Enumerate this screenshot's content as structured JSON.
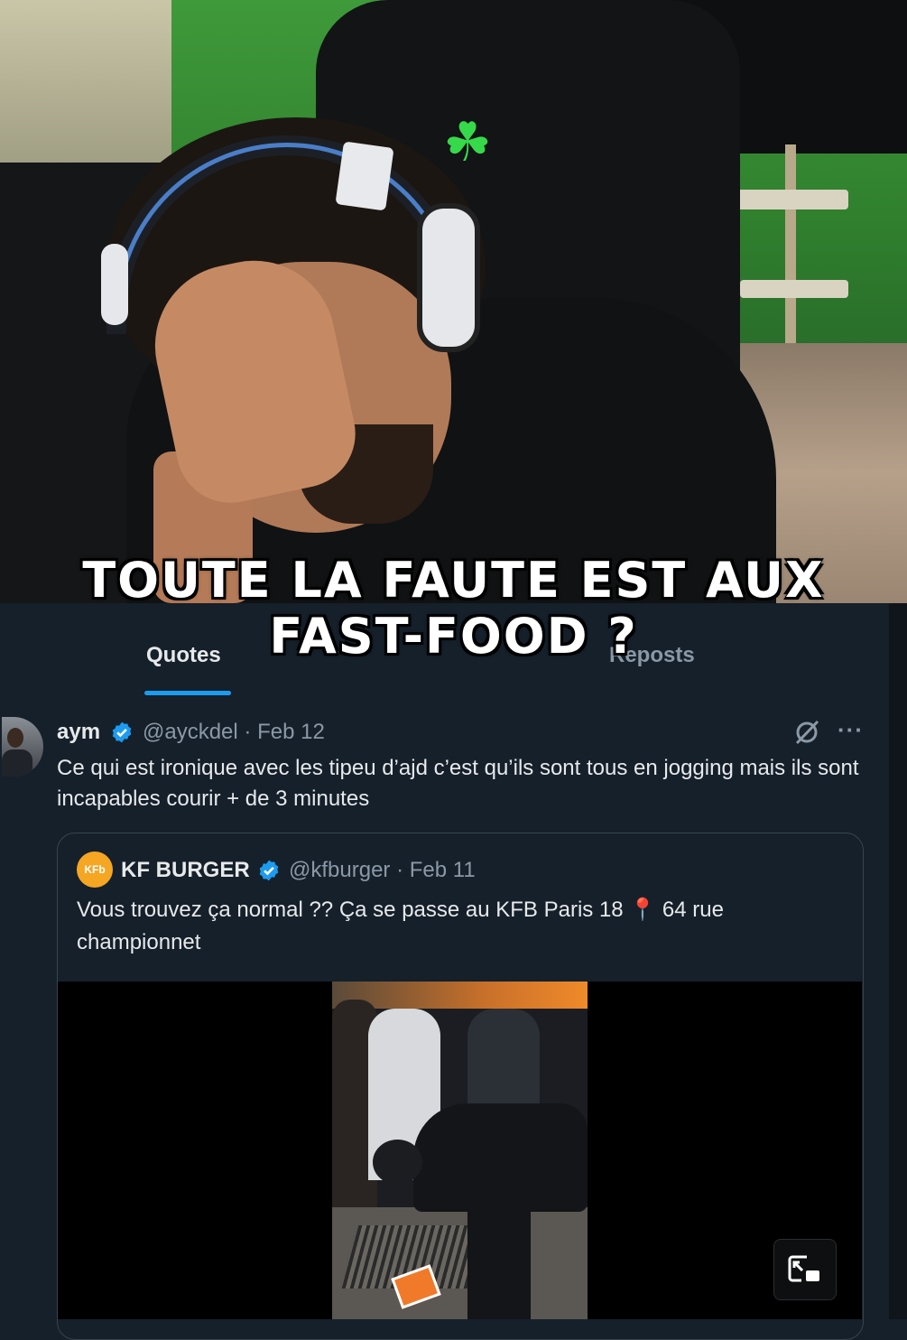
{
  "caption": {
    "line1": "TOUTE LA FAUTE EST AUX",
    "line2": "FAST-FOOD ?"
  },
  "tabs": [
    {
      "label": "Quotes",
      "selected": true
    },
    {
      "label": "Reposts",
      "selected": false
    }
  ],
  "tweet": {
    "name": "aym",
    "handle": "@ayckdel · Feb 12",
    "text": "Ce qui est ironique avec les tipeu d’ajd c’est qu’ils sont tous en jogging mais ils sont incapables courir + de 3 minutes",
    "more": "···"
  },
  "quoted_tweet": {
    "avatar_text": "KFb",
    "name": "KF BURGER",
    "handle": "@kfburger · Feb 11",
    "text_before_pin": "Vous trouvez ça normal ?? Ça se passe au KFB Paris 18 ",
    "pin": "📍",
    "text_after_pin": " 64 rue championnet"
  },
  "icons": {
    "verified": "verified-badge-icon",
    "grok": "grok-icon",
    "more": "more-icon",
    "pip": "picture-in-picture-icon",
    "chair_logo": "razer-logo-icon"
  },
  "colors": {
    "background": "#15202b",
    "accent": "#1d9bf0",
    "secondary_text": "#8b98a5",
    "border": "#38444d"
  }
}
